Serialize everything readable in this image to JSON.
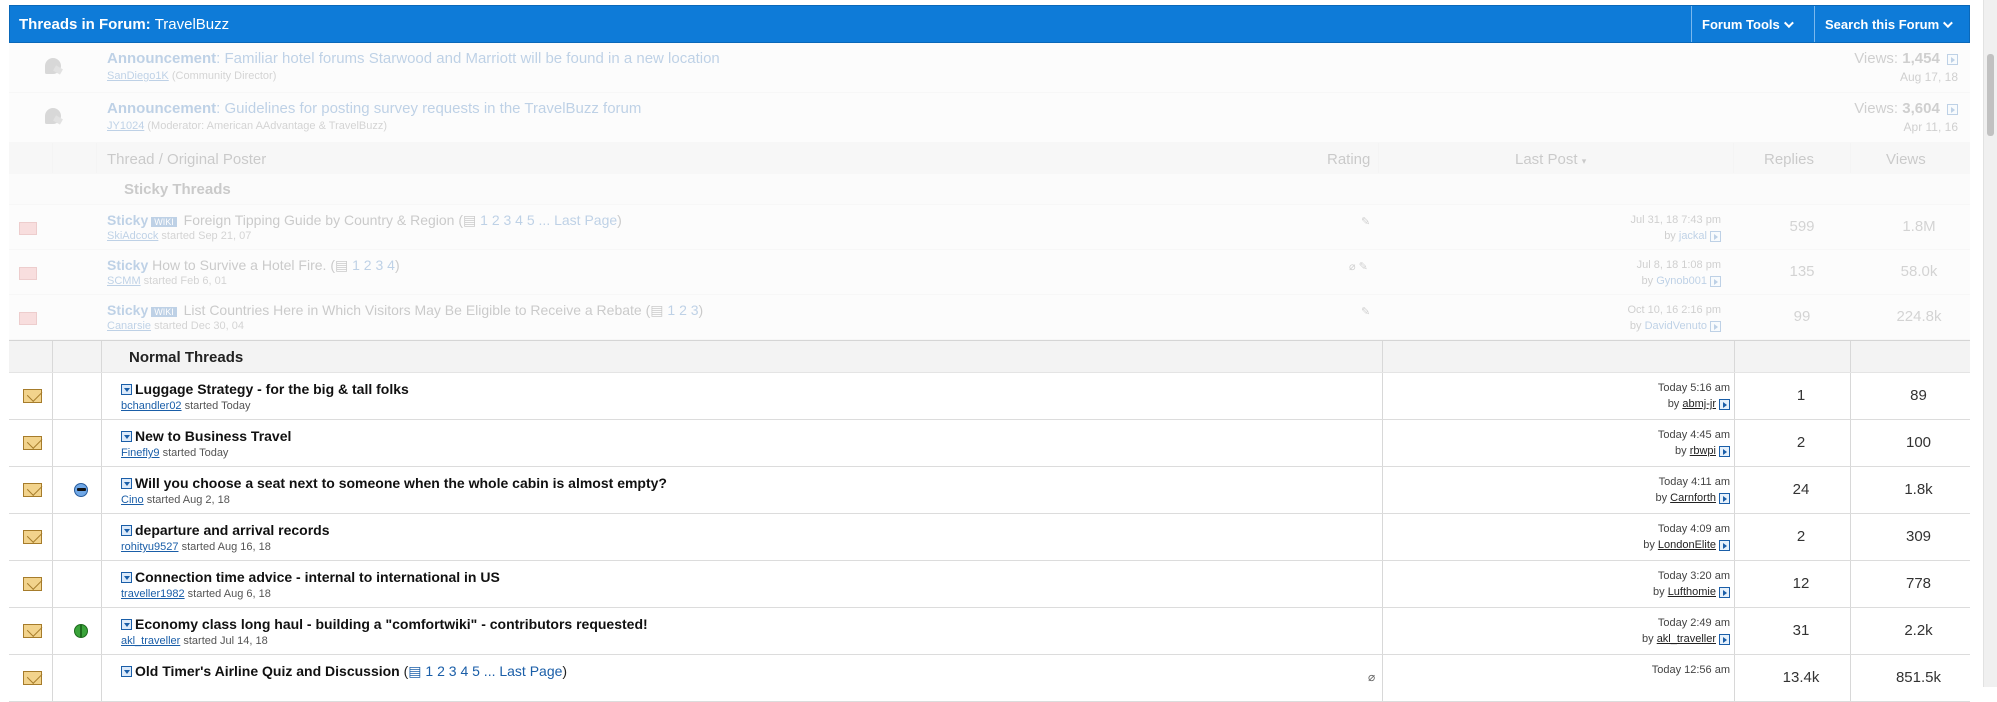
{
  "header": {
    "title_prefix": "Threads in Forum:",
    "forum_name": "TravelBuzz",
    "forum_tools_label": "Forum Tools",
    "search_label": "Search this Forum"
  },
  "announcements": [
    {
      "label": "Announcement",
      "title": "Familiar hotel forums Starwood and Marriott will be found in a new location",
      "author": "SanDiego1K",
      "role": "(Community Director)",
      "views_label": "Views:",
      "views": "1,454",
      "date": "Aug 17, 18"
    },
    {
      "label": "Announcement",
      "title": "Guidelines for posting survey requests in the TravelBuzz forum",
      "author": "JY1024",
      "role": "(Moderator: American AAdvantage & TravelBuzz)",
      "views_label": "Views:",
      "views": "3,604",
      "date": "Apr 11, 16"
    }
  ],
  "columns": {
    "thread": "Thread / Original Poster",
    "rating": "Rating",
    "last_post": "Last Post",
    "replies": "Replies",
    "views": "Views"
  },
  "sticky_header": "Sticky Threads",
  "sticky_threads": [
    {
      "label": "Sticky",
      "wiki": "WIKI",
      "title": "Foreign Tipping Guide by Country & Region",
      "pages": "1 2 3 4 5 ... Last Page",
      "author": "SkiAdcock",
      "started": "started Sep 21, 07",
      "last_time": "Jul 31, 18 7:43 pm",
      "last_by": "jackal",
      "replies": "599",
      "views": "1.8M"
    },
    {
      "label": "Sticky",
      "wiki": "",
      "title": "How to Survive a Hotel Fire.",
      "pages": "1 2 3 4",
      "author": "SCMM",
      "started": "started Feb 6, 01",
      "last_time": "Jul 8, 18 1:08 pm",
      "last_by": "Gynob001",
      "replies": "135",
      "views": "58.0k"
    },
    {
      "label": "Sticky",
      "wiki": "WIKI",
      "title": "List Countries Here in Which Visitors May Be Eligible to Receive a Rebate",
      "pages": "1 2 3",
      "author": "Canarsie",
      "started": "started Dec 30, 04",
      "last_time": "Oct 10, 16 2:16 pm",
      "last_by": "DavidVenuto",
      "replies": "99",
      "views": "224.8k"
    }
  ],
  "normal_header": "Normal Threads",
  "threads": [
    {
      "title": "Luggage Strategy - for the big & tall folks",
      "author": "bchandler02",
      "started": "started Today",
      "last_time": "Today 5:16 am",
      "by": "by",
      "last_by": "abmj-jr",
      "replies": "1",
      "views": "89",
      "icon": ""
    },
    {
      "title": "New to Business Travel",
      "author": "Finefly9",
      "started": "started Today",
      "last_time": "Today 4:45 am",
      "by": "by",
      "last_by": "rbwpi",
      "replies": "2",
      "views": "100",
      "icon": ""
    },
    {
      "title": "Will you choose a seat next to someone when the whole cabin is almost empty?",
      "author": "Cino",
      "started": "started Aug 2, 18",
      "last_time": "Today 4:11 am",
      "by": "by",
      "last_by": "Carnforth",
      "replies": "24",
      "views": "1.8k",
      "icon": "cool-icon"
    },
    {
      "title": "departure and arrival records",
      "author": "rohityu9527",
      "started": "started Aug 16, 18",
      "last_time": "Today 4:09 am",
      "by": "by",
      "last_by": "LondonElite",
      "replies": "2",
      "views": "309",
      "icon": ""
    },
    {
      "title": "Connection time advice - internal to international in US",
      "author": "traveller1982",
      "started": "started Aug 6, 18",
      "last_time": "Today 3:20 am",
      "by": "by",
      "last_by": "Lufthomie",
      "replies": "12",
      "views": "778",
      "icon": ""
    },
    {
      "title": "Economy class long haul - building a \"comfortwiki\" - contributors requested!",
      "author": "akl_traveller",
      "started": "started Jul 14, 18",
      "last_time": "Today 2:49 am",
      "by": "by",
      "last_by": "akl_traveller",
      "replies": "31",
      "views": "2.2k",
      "icon": "globe-icon"
    },
    {
      "title": "Old Timer's Airline Quiz and Discussion",
      "author": "",
      "started": "",
      "last_time": "Today 12:56 am",
      "by": "",
      "last_by": "",
      "replies": "13.4k",
      "views": "851.5k",
      "icon": "",
      "pages": "1 2 3 4 5 ... Last Page"
    }
  ]
}
